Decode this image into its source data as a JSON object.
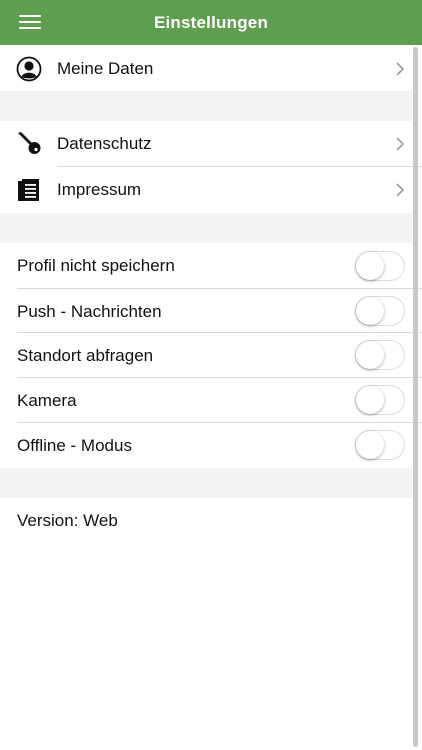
{
  "header": {
    "title": "Einstellungen",
    "menu_icon": "hamburger-menu-icon"
  },
  "section1": [
    {
      "label": "Meine Daten",
      "icon": "user-icon"
    }
  ],
  "section2": [
    {
      "label": "Datenschutz",
      "icon": "key-icon"
    },
    {
      "label": "Impressum",
      "icon": "document-icon"
    }
  ],
  "toggles": [
    {
      "label": "Profil nicht speichern",
      "checked": false
    },
    {
      "label": "Push - Nachrichten",
      "checked": false
    },
    {
      "label": "Standort abfragen",
      "checked": false
    },
    {
      "label": "Kamera",
      "checked": false
    },
    {
      "label": "Offline - Modus",
      "checked": false
    }
  ],
  "footer": {
    "version": "Version: Web"
  },
  "colors": {
    "appbar": "#5f9e4f",
    "section_gap": "#f3f3f3"
  }
}
